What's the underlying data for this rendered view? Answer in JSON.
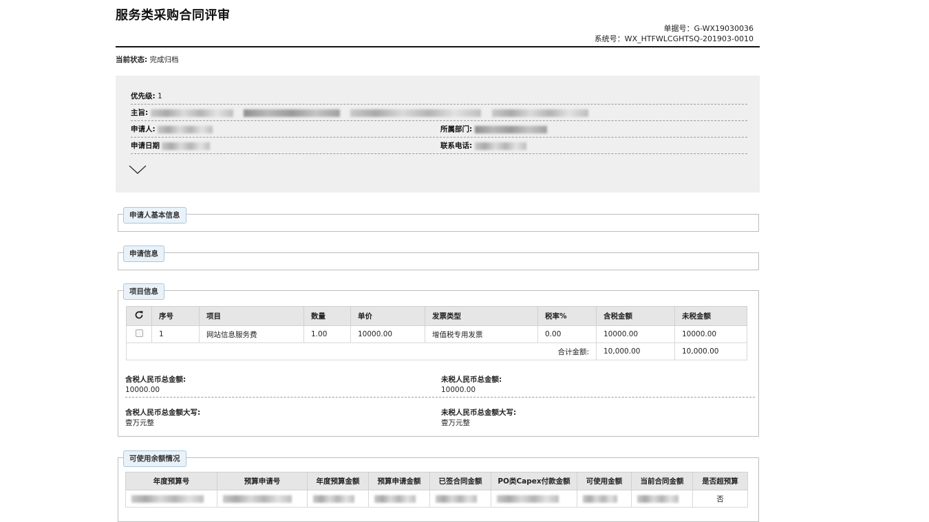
{
  "header": {
    "title": "服务类采购合同评审",
    "doc_no": "单据号：G-WX19030036",
    "sys_no": "系统号：WX_HTFWLCGHTSQ-201903-0010"
  },
  "status": {
    "label": "当前状态:",
    "value": "完成归档"
  },
  "summary": {
    "priority_label": "优先级:",
    "priority_value": "1",
    "subject_label": "主旨:",
    "applicant_label": "申请人:",
    "department_label": "所属部门:",
    "date_label": "申请日期",
    "phone_label": "联系电话:"
  },
  "sections": {
    "applicant_info": "申请人基本信息",
    "application_info": "申请信息",
    "project_info": "项目信息",
    "balance": "可使用余额情况"
  },
  "items_table": {
    "refresh_icon": "refresh-icon",
    "columns": [
      "序号",
      "项目",
      "数量",
      "单价",
      "发票类型",
      "税率%",
      "含税金额",
      "未税金额"
    ],
    "rows": [
      {
        "no": "1",
        "item": "网站信息服务费",
        "qty": "1.00",
        "price": "10000.00",
        "invoice": "增值税专用发票",
        "tax": "0.00",
        "gross": "10000.00",
        "net": "10000.00"
      }
    ],
    "total_label": "合计金额:",
    "total_gross": "10,000.00",
    "total_net": "10,000.00"
  },
  "totals": {
    "gross_label": "含税人民币总金额:",
    "gross_value": "10000.00",
    "net_label": "未税人民币总金额:",
    "net_value": "10000.00",
    "gross_words_label": "含税人民币总金额大写:",
    "gross_words_value": "壹万元整",
    "net_words_label": "未税人民币总金额大写:",
    "net_words_value": "壹万元整"
  },
  "budget_table": {
    "columns": [
      "年度预算号",
      "预算申请号",
      "年度预算金额",
      "预算申请金额",
      "已签合同金额",
      "PO类Capex付款金额",
      "可使用金额",
      "当前合同金额",
      "是否超预算"
    ],
    "over_budget_value": "否"
  },
  "colors": {
    "summary_bg": "#efefef",
    "legend_bg": "#e9f2f9",
    "header_rule": "#111111"
  }
}
